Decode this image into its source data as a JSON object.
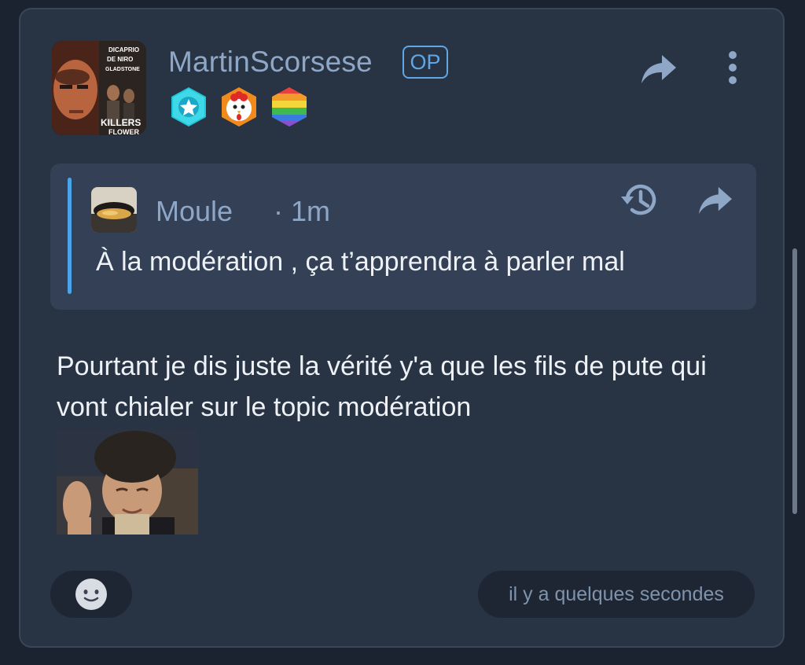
{
  "post": {
    "username": "MartinScorsese",
    "op_badge": "OP",
    "avatar": {
      "poster_names": [
        "DICAPRIO",
        "DE NIRO",
        "GLADSTONE"
      ],
      "poster_title_1": "KILLERS",
      "poster_title_2": "FLOWER"
    },
    "badges": [
      "star-badge-icon",
      "chicken-badge-icon",
      "rainbow-badge-icon"
    ],
    "actions": [
      "share-icon",
      "more-options-icon"
    ],
    "quote": {
      "author": "Moule",
      "time": "· 1m",
      "text": "À la modération , ça t’apprendra à parler mal",
      "actions": [
        "history-icon",
        "share-icon"
      ]
    },
    "body": "Pourtant je dis juste la vérité y'a que les fils de pute qui vont chialer sur le topic modération",
    "footer": {
      "emoji_button": "smiley-icon",
      "timestamp": "il y a quelques secondes"
    }
  },
  "colors": {
    "page_background": "#1b2330",
    "card_background": "#283343",
    "quote_background": "#334055",
    "accent_blue": "#5fa7e6",
    "muted_text": "#8fa7c7",
    "main_text": "#eef2f7"
  }
}
